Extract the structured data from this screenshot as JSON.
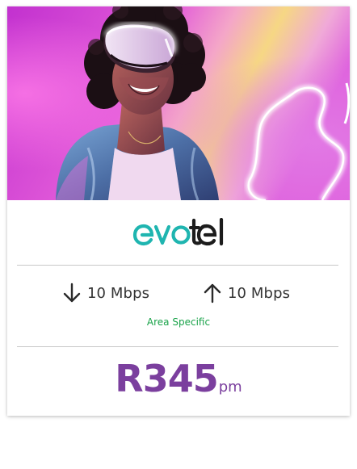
{
  "hero": {
    "image_icon": "woman-wearing-vr-headset-photo",
    "colors": {
      "magenta": "#d23bd6",
      "pink": "#f06ad8",
      "yellow": "#f3d27a",
      "neon": "#ffffff"
    }
  },
  "brand": {
    "name_part1": "evo",
    "name_part2": "tel",
    "color_part1": "#1fb5b0",
    "color_part2": "#1c1c1c"
  },
  "speeds": {
    "download": {
      "label": "10 Mbps",
      "icon": "arrow-down-icon"
    },
    "upload": {
      "label": "10 Mbps",
      "icon": "arrow-up-icon"
    }
  },
  "area_note": "Area Specific",
  "price": {
    "amount": "R345",
    "unit": "pm",
    "color": "#7b3f9e"
  }
}
